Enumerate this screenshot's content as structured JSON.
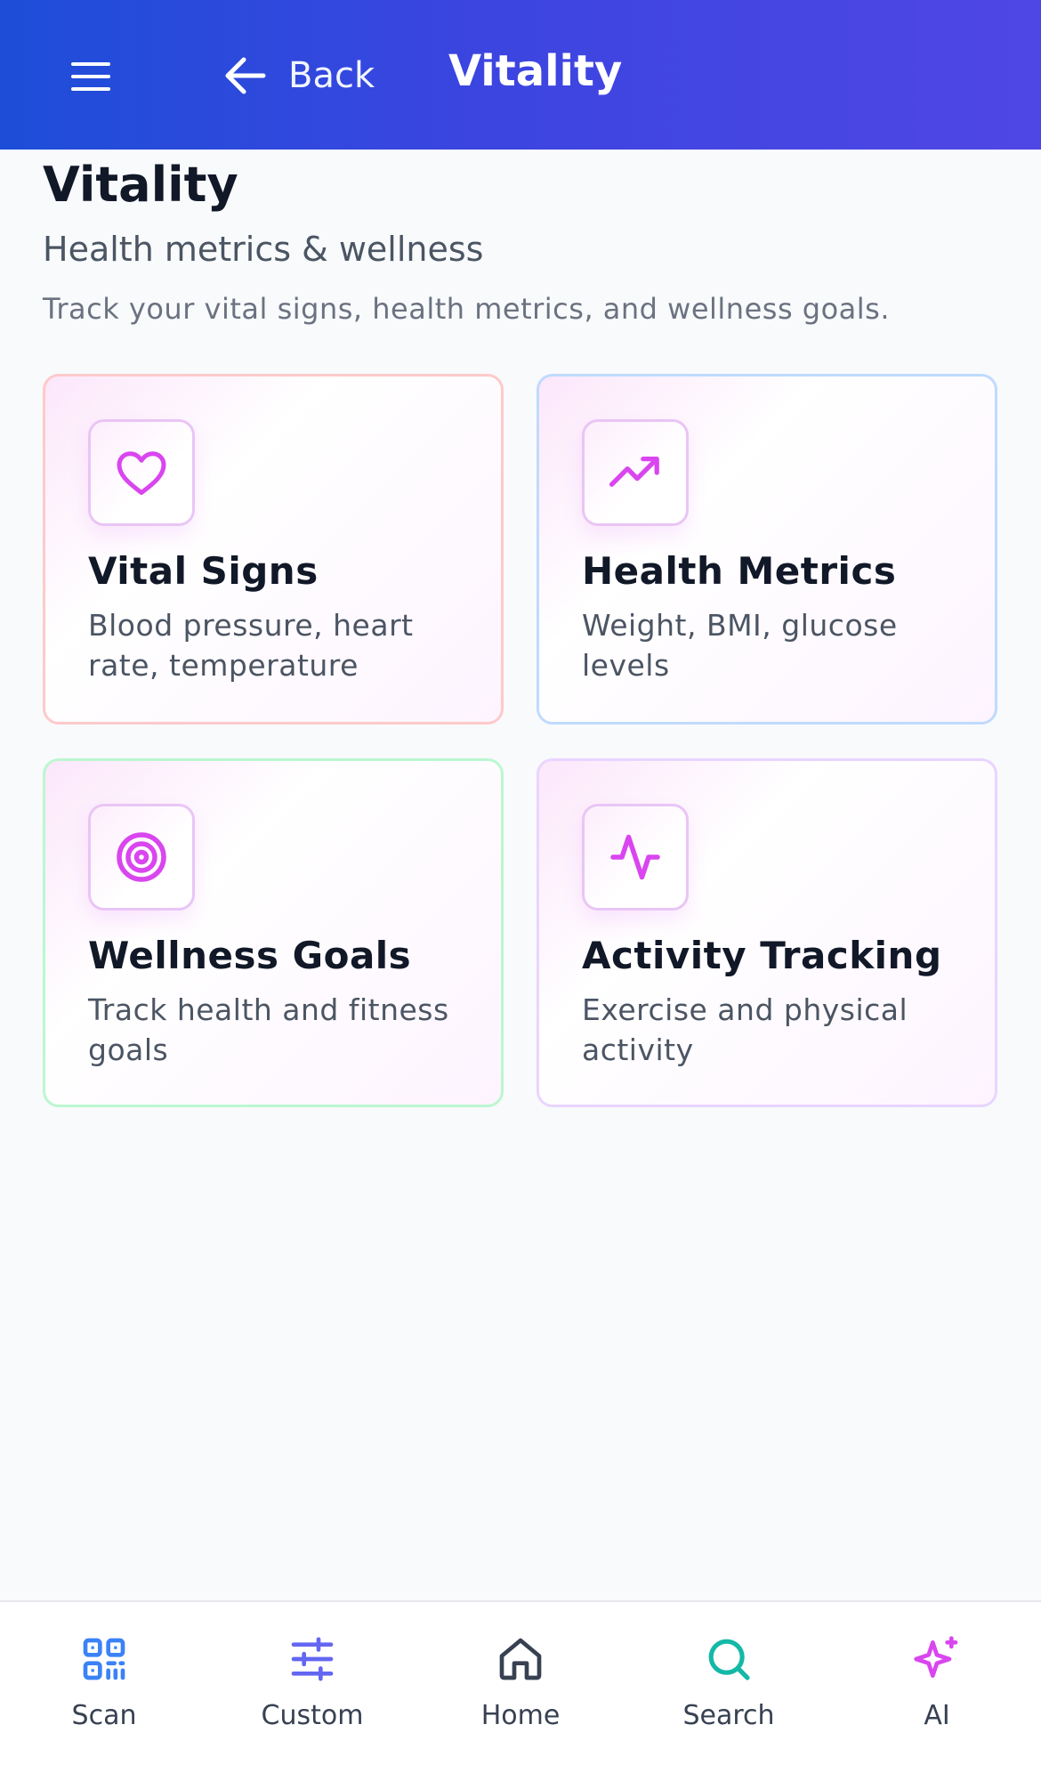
{
  "header": {
    "menu_icon": "hamburger-menu-icon",
    "back_label": "Back",
    "title": "Vitality"
  },
  "page": {
    "title": "Vitality",
    "subtitle": "Health metrics & wellness",
    "description": "Track your vital signs, health metrics, and wellness goals."
  },
  "cards": [
    {
      "title": "Vital Signs",
      "description": "Blood pressure, heart rate, temperature",
      "icon": "heart-icon",
      "border_color": "#fecaca"
    },
    {
      "title": "Health Metrics",
      "description": "Weight, BMI, glucose levels",
      "icon": "trending-up-icon",
      "border_color": "#bfdbfe"
    },
    {
      "title": "Wellness Goals",
      "description": "Track health and fitness goals",
      "icon": "target-icon",
      "border_color": "#bbf7d0"
    },
    {
      "title": "Activity Tracking",
      "description": "Exercise and physical activity",
      "icon": "activity-icon",
      "border_color": "#e9d5ff"
    }
  ],
  "colors": {
    "accent_magenta": "#d946ef",
    "header_start": "#1d4ed8",
    "header_end": "#4f46e5"
  },
  "bottom_nav": [
    {
      "label": "Scan",
      "icon": "qr-code-icon",
      "color": "#3b82f6"
    },
    {
      "label": "Custom",
      "icon": "sliders-icon",
      "color": "#6366f1"
    },
    {
      "label": "Home",
      "icon": "home-icon",
      "color": "#374151"
    },
    {
      "label": "Search",
      "icon": "search-icon",
      "color": "#14b8a6"
    },
    {
      "label": "AI",
      "icon": "sparkles-icon",
      "color": "#d946ef"
    }
  ]
}
